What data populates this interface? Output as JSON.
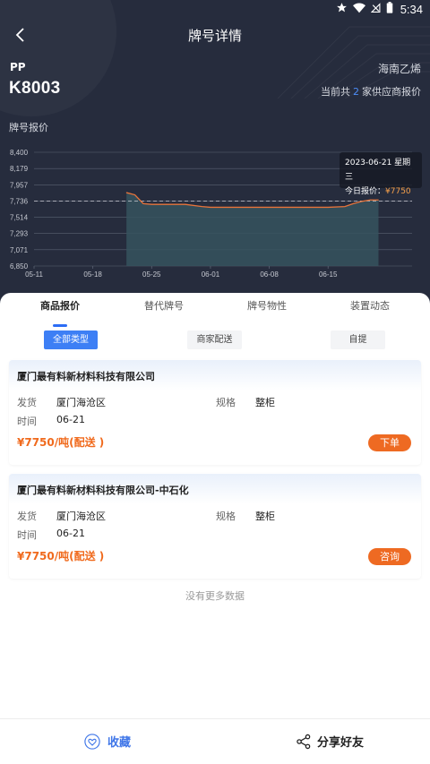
{
  "status_bar": {
    "time": "5:34",
    "icons": [
      "star-icon",
      "wifi-icon",
      "signal-icon",
      "battery-icon"
    ]
  },
  "header": {
    "title": "牌号详情"
  },
  "product": {
    "category": "PP",
    "grade": "K8003",
    "producer": "海南乙烯",
    "suppliers_prefix": "当前共",
    "suppliers_count": "2",
    "suppliers_suffix": "家供应商报价"
  },
  "chart_title": "牌号报价",
  "chart_data": {
    "type": "area",
    "title": "",
    "xlabel": "",
    "ylabel": "",
    "ylim": [
      6850,
      8400
    ],
    "y_ticks": [
      "8,400",
      "8,179",
      "7,957",
      "7,736",
      "7,514",
      "7,293",
      "7,071",
      "6,850"
    ],
    "x_ticks": [
      "05-11",
      "05-18",
      "05-25",
      "06-01",
      "06-08",
      "06-15"
    ],
    "grid": true,
    "reference_line": 7736,
    "series": [
      {
        "x": [
          "05-22",
          "05-23",
          "05-24",
          "05-25",
          "05-26",
          "05-29",
          "05-31",
          "06-01",
          "06-05",
          "06-08",
          "06-10",
          "06-15",
          "06-17",
          "06-18",
          "06-19",
          "06-20",
          "06-21"
        ],
        "values": [
          7850,
          7820,
          7700,
          7690,
          7690,
          7690,
          7660,
          7650,
          7650,
          7650,
          7650,
          7650,
          7660,
          7700,
          7730,
          7750,
          7750
        ]
      }
    ],
    "colors": {
      "line": "#e8743b",
      "area": "#36545e",
      "grid": "#5b6273",
      "axis_text": "#c5c8d0"
    }
  },
  "tooltip": {
    "date_line": "2023-06-21 星期三",
    "label": "今日报价：",
    "price": "¥7750"
  },
  "tabs": [
    {
      "label": "商品报价"
    },
    {
      "label": "替代牌号"
    },
    {
      "label": "牌号物性"
    },
    {
      "label": "装置动态"
    }
  ],
  "filters": [
    {
      "label": "全部类型"
    },
    {
      "label": "商家配送"
    },
    {
      "label": "自提"
    }
  ],
  "offers": [
    {
      "company": "厦门最有料新材料科技有限公司",
      "ship_label": "发货",
      "ship_value": "厦门海沧区",
      "spec_label": "规格",
      "spec_value": "整柜",
      "time_label": "时间",
      "time_value": "06-21",
      "price": "¥7750/吨(配送 )",
      "action": "下单"
    },
    {
      "company": "厦门最有料新材料科技有限公司-中石化",
      "ship_label": "发货",
      "ship_value": "厦门海沧区",
      "spec_label": "规格",
      "spec_value": "整柜",
      "time_label": "时间",
      "time_value": "06-21",
      "price": "¥7750/吨(配送 )",
      "action": "咨询"
    }
  ],
  "no_more": "没有更多数据",
  "bottom": {
    "favorite": "收藏",
    "share": "分享好友"
  }
}
